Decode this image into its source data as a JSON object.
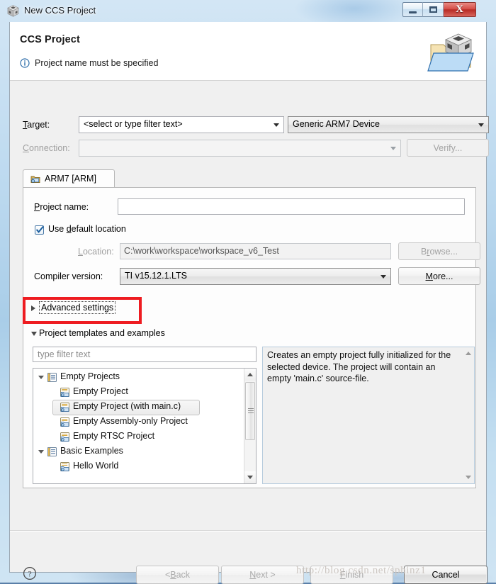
{
  "window": {
    "title": "New CCS Project",
    "icon": "cube-icon",
    "controls": {
      "minimize": "minimize-button",
      "maximize": "maximize-button",
      "close": "close-button",
      "close_glyph": "X"
    }
  },
  "header": {
    "title": "CCS Project",
    "message": "Project name must be specified",
    "message_icon": "info-icon",
    "graphic": "project-folder-cube-icon"
  },
  "target_row": {
    "target_label": "Target:",
    "target_filter_value": "<select or type filter text>",
    "target_device_value": "Generic ARM7 Device",
    "connection_label": "Connection:",
    "connection_value": "",
    "verify_button": "Verify...",
    "connection_enabled": false,
    "verify_enabled": false
  },
  "tab": {
    "label": "ARM7 [ARM]",
    "icon": "device-chip-icon"
  },
  "form": {
    "project_name_label": "Project name:",
    "project_name_value": "",
    "use_default_location_label": "Use default location",
    "use_default_location_checked": true,
    "location_label": "Location:",
    "location_value": "C:\\work\\workspace\\workspace_v6_Test",
    "browse_button": "Browse...",
    "compiler_label": "Compiler version:",
    "compiler_value": "TI v15.12.1.LTS",
    "more_button": "More..."
  },
  "sections": {
    "advanced_settings": {
      "label": "Advanced settings",
      "expanded": false,
      "highlighted": true,
      "highlight_color": "#ee1c21"
    },
    "project_templates": {
      "label": "Project templates and examples",
      "expanded": true
    }
  },
  "filter": {
    "placeholder": "type filter text",
    "value": ""
  },
  "tree": {
    "items": [
      {
        "label": "Empty Projects",
        "level": 0,
        "icon": "category-icon",
        "expandable": true,
        "expanded": true,
        "selected": false
      },
      {
        "label": "Empty Project",
        "level": 1,
        "icon": "project-icon",
        "expandable": false,
        "expanded": false,
        "selected": false
      },
      {
        "label": "Empty Project (with main.c)",
        "level": 1,
        "icon": "project-icon",
        "expandable": false,
        "expanded": false,
        "selected": true
      },
      {
        "label": "Empty Assembly-only Project",
        "level": 1,
        "icon": "project-icon",
        "expandable": false,
        "expanded": false,
        "selected": false
      },
      {
        "label": "Empty RTSC Project",
        "level": 1,
        "icon": "project-icon",
        "expandable": false,
        "expanded": false,
        "selected": false
      },
      {
        "label": "Basic Examples",
        "level": 0,
        "icon": "category-icon",
        "expandable": true,
        "expanded": true,
        "selected": false
      },
      {
        "label": "Hello World",
        "level": 1,
        "icon": "project-icon",
        "expandable": false,
        "expanded": false,
        "selected": false
      }
    ]
  },
  "description": {
    "text": "Creates an empty project fully initialized for the selected device. The project will contain an empty 'main.c' source-file."
  },
  "footer": {
    "help_icon": "help-question-icon",
    "back_button": "< Back",
    "next_button": "Next >",
    "finish_button": "Finish",
    "cancel_button": "Cancel",
    "back_enabled": false,
    "next_enabled": false,
    "finish_enabled": false,
    "cancel_enabled": true
  },
  "watermark": {
    "text": "http://blog.csdn.net/sphinz1"
  }
}
